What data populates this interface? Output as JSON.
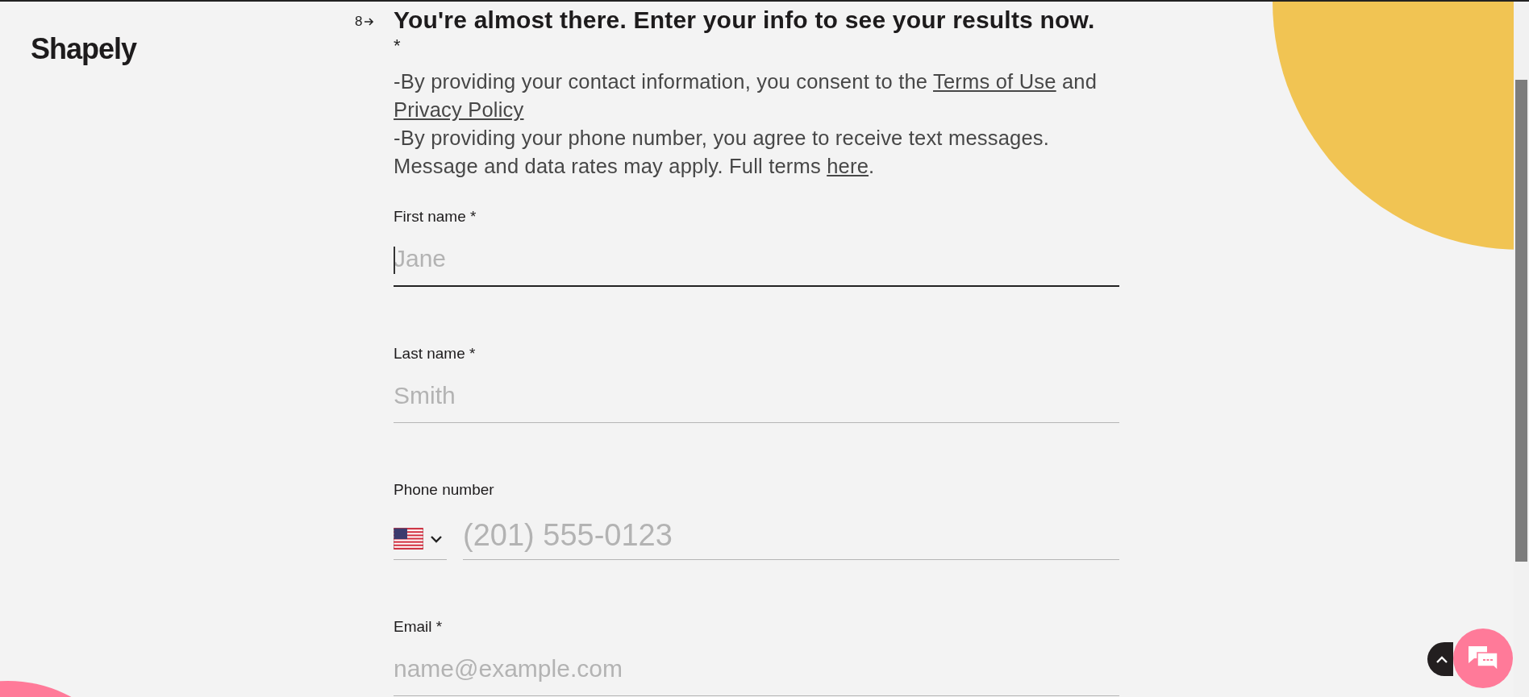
{
  "logo": "Shapely",
  "question": {
    "number": "8",
    "title": "You're almost there. Enter your info to see your results now.",
    "required_mark": "*",
    "consent": [
      [
        {
          "kind": "text",
          "text": "-By providing your contact information, you consent to the "
        },
        {
          "kind": "link",
          "text": "Terms of Use"
        },
        {
          "kind": "text",
          "text": " and "
        },
        {
          "kind": "link",
          "text": "Privacy Policy"
        }
      ],
      [
        {
          "kind": "text",
          "text": "-By providing your phone number, you agree to receive text messages. Message and data rates may apply. Full terms "
        },
        {
          "kind": "link",
          "text": "here"
        },
        {
          "kind": "text",
          "text": "."
        }
      ]
    ]
  },
  "fields": [
    {
      "kind": "text",
      "label": "First name *",
      "placeholder": "Jane",
      "focused": true
    },
    {
      "kind": "text",
      "label": "Last name *",
      "placeholder": "Smith",
      "focused": false
    },
    {
      "kind": "phone",
      "label": "Phone number",
      "placeholder": "(201) 555-0123",
      "focused": false
    },
    {
      "kind": "text",
      "label": "Email *",
      "placeholder": "name@example.com",
      "focused": false
    }
  ]
}
